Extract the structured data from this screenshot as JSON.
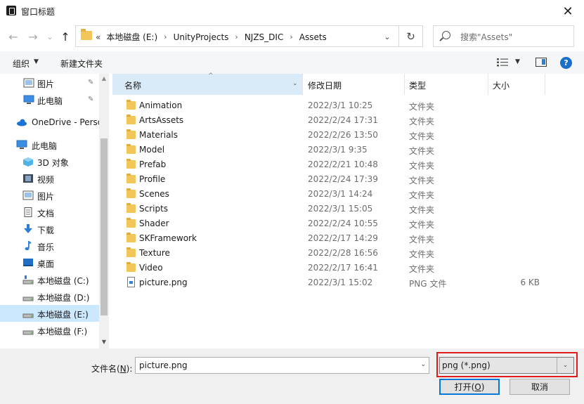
{
  "window": {
    "title": "窗口标题",
    "close_glyph": "✕"
  },
  "nav": {
    "back_glyph": "←",
    "forward_glyph": "→",
    "recent_glyph": "⌄",
    "up_glyph": "↑",
    "overflow": "«",
    "breadcrumbs": [
      "本地磁盘 (E:)",
      "UnityProjects",
      "NJZS_DIC",
      "Assets"
    ],
    "separator": "›",
    "dropdown_glyph": "⌄",
    "refresh_glyph": "↻",
    "search_placeholder": "搜索\"Assets\""
  },
  "toolbar": {
    "organize": "组织",
    "organize_caret": "▼",
    "new_folder": "新建文件夹",
    "view_caret": "▼",
    "help": "?"
  },
  "sidebar": {
    "pin_glyph": "📌",
    "items": [
      {
        "label": "图片",
        "icon": "pictures-icon",
        "pinned": true
      },
      {
        "label": "此电脑",
        "icon": "pc-icon",
        "pinned": true
      },
      {
        "label": "OneDrive - Perso",
        "icon": "onedrive-icon"
      },
      {
        "label": "此电脑",
        "icon": "pc-icon"
      },
      {
        "label": "3D 对象",
        "icon": "3d-objects-icon"
      },
      {
        "label": "视频",
        "icon": "video-icon"
      },
      {
        "label": "图片",
        "icon": "pictures-icon"
      },
      {
        "label": "文档",
        "icon": "documents-icon"
      },
      {
        "label": "下载",
        "icon": "download-icon"
      },
      {
        "label": "音乐",
        "icon": "music-icon"
      },
      {
        "label": "桌面",
        "icon": "desktop-icon"
      },
      {
        "label": "本地磁盘 (C:)",
        "icon": "drive-icon"
      },
      {
        "label": "本地磁盘 (D:)",
        "icon": "drive-icon"
      },
      {
        "label": "本地磁盘 (E:)",
        "icon": "drive-icon",
        "selected": true
      },
      {
        "label": "本地磁盘 (F:)",
        "icon": "drive-icon"
      }
    ],
    "scroll_up": "▲",
    "scroll_down": "▼"
  },
  "columns": {
    "name": "名称",
    "date": "修改日期",
    "type": "类型",
    "size": "大小",
    "sort_glyph": "^",
    "dd_glyph": "⌄"
  },
  "files": [
    {
      "name": "Animation",
      "date": "2022/3/1 10:25",
      "type": "文件夹",
      "size": "",
      "kind": "folder"
    },
    {
      "name": "ArtsAssets",
      "date": "2022/2/24 17:31",
      "type": "文件夹",
      "size": "",
      "kind": "folder"
    },
    {
      "name": "Materials",
      "date": "2022/2/26 13:50",
      "type": "文件夹",
      "size": "",
      "kind": "folder"
    },
    {
      "name": "Model",
      "date": "2022/3/1 9:35",
      "type": "文件夹",
      "size": "",
      "kind": "folder"
    },
    {
      "name": "Prefab",
      "date": "2022/2/21 10:48",
      "type": "文件夹",
      "size": "",
      "kind": "folder"
    },
    {
      "name": "Profile",
      "date": "2022/2/24 17:39",
      "type": "文件夹",
      "size": "",
      "kind": "folder"
    },
    {
      "name": "Scenes",
      "date": "2022/3/1 14:24",
      "type": "文件夹",
      "size": "",
      "kind": "folder"
    },
    {
      "name": "Scripts",
      "date": "2022/3/1 15:05",
      "type": "文件夹",
      "size": "",
      "kind": "folder"
    },
    {
      "name": "Shader",
      "date": "2022/2/24 10:55",
      "type": "文件夹",
      "size": "",
      "kind": "folder"
    },
    {
      "name": "SKFramework",
      "date": "2022/2/17 14:29",
      "type": "文件夹",
      "size": "",
      "kind": "folder"
    },
    {
      "name": "Texture",
      "date": "2022/2/28 16:56",
      "type": "文件夹",
      "size": "",
      "kind": "folder"
    },
    {
      "name": "Video",
      "date": "2022/2/17 16:41",
      "type": "文件夹",
      "size": "",
      "kind": "folder"
    },
    {
      "name": "picture.png",
      "date": "2022/3/1 15:02",
      "type": "PNG 文件",
      "size": "6 KB",
      "kind": "png"
    }
  ],
  "footer": {
    "filename_label_main": "文件名(",
    "filename_label_key": "N",
    "filename_label_end": "):",
    "filename_value": "picture.png",
    "dd_glyph": "⌄",
    "filetype_value": "png (*.png)",
    "open_main": "打开(",
    "open_key": "O",
    "open_end": ")",
    "cancel": "取消"
  }
}
